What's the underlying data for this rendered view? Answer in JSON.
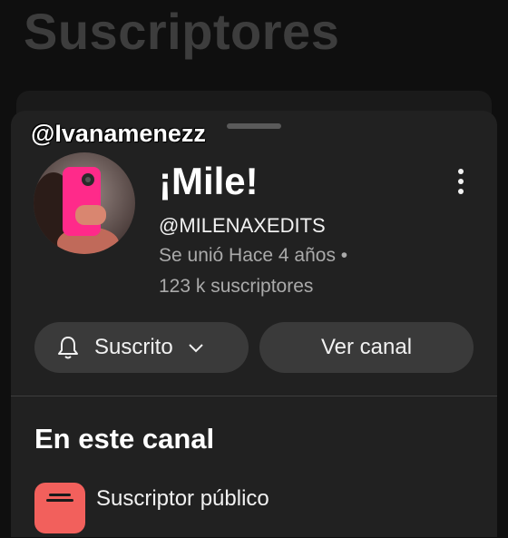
{
  "background": {
    "title": "Suscriptores"
  },
  "watermark": {
    "text": "@Ivanamenezz"
  },
  "channel": {
    "name": "¡Mile!",
    "handle": "@MILENAXEDITS",
    "joined": "Se unió Hace 4 años •",
    "subscribers": "123 k suscriptores"
  },
  "actions": {
    "subscribed_label": "Suscrito",
    "view_channel_label": "Ver canal"
  },
  "section": {
    "title": "En este canal",
    "items": [
      {
        "label": "Suscriptor público",
        "icon": "subscriptions-icon"
      }
    ]
  },
  "colors": {
    "background": "#0f0f0f",
    "sheet": "#212121",
    "pill": "#3a3a3a",
    "icon_accent": "#f2605c"
  }
}
